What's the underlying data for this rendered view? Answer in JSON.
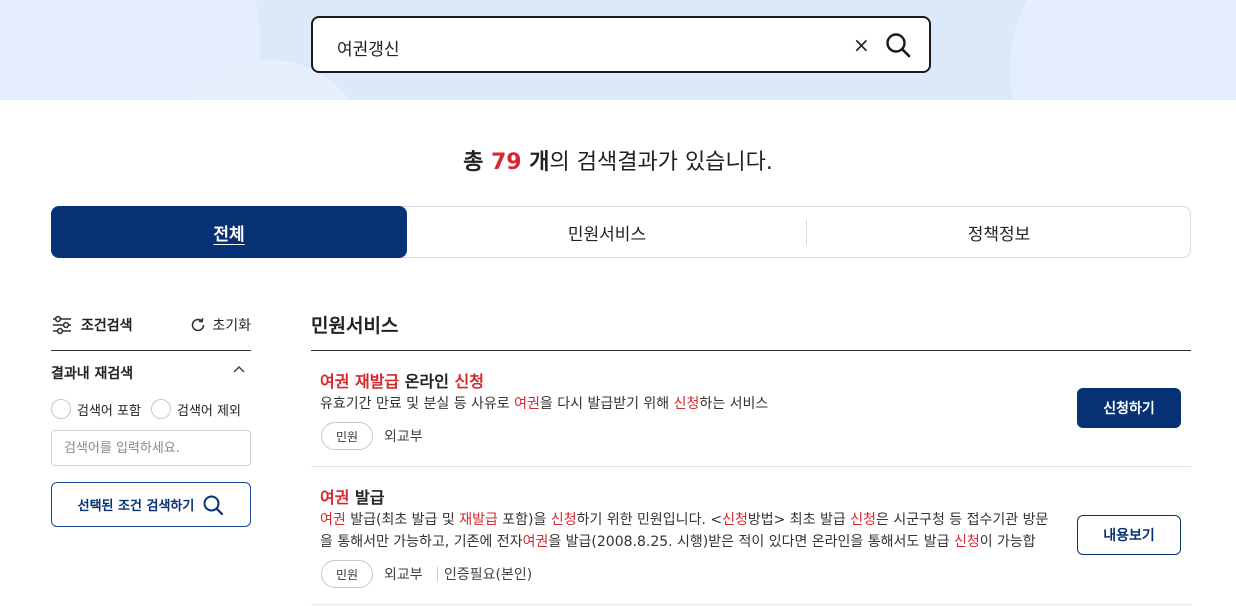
{
  "search": {
    "value": "여권갱신",
    "clear_icon": "×"
  },
  "result_summary": {
    "prefix": "총 ",
    "count": "79",
    "unit": " 개",
    "suffix": "의 검색결과가 있습니다."
  },
  "tabs": [
    {
      "label": "전체",
      "active": true
    },
    {
      "label": "민원서비스",
      "active": false
    },
    {
      "label": "정책정보",
      "active": false
    }
  ],
  "filter": {
    "title": "조건검색",
    "reset_label": "초기화",
    "refine_title": "결과내 재검색",
    "options": [
      {
        "label": "검색어 포함"
      },
      {
        "label": "검색어 제외"
      }
    ],
    "input_placeholder": "검색어를 입력하세요.",
    "apply_label": "선택된 조건 검색하기"
  },
  "section": {
    "title": "민원서비스"
  },
  "results": [
    {
      "title_parts": [
        {
          "text": "여권",
          "hl": true
        },
        {
          "text": " ",
          "hl": false
        },
        {
          "text": "재발급",
          "hl": true
        },
        {
          "text": " 온라인 ",
          "hl": false
        },
        {
          "text": "신청",
          "hl": true
        }
      ],
      "desc_parts": [
        {
          "text": "유효기간 만료 및 분실 등 사유로 ",
          "hl": false
        },
        {
          "text": "여권",
          "hl": true
        },
        {
          "text": "을 다시 발급받기 위해 ",
          "hl": false
        },
        {
          "text": "신청",
          "hl": true
        },
        {
          "text": "하는 서비스",
          "hl": false
        }
      ],
      "tag": "민원",
      "meta": [
        "외교부"
      ],
      "button": "신청하기"
    },
    {
      "title_parts": [
        {
          "text": "여권",
          "hl": true
        },
        {
          "text": " 발급",
          "hl": false
        }
      ],
      "desc_parts": [
        {
          "text": "여권",
          "hl": true
        },
        {
          "text": " 발급(최초 발급 및 ",
          "hl": false
        },
        {
          "text": "재발급",
          "hl": true
        },
        {
          "text": " 포함)을 ",
          "hl": false
        },
        {
          "text": "신청",
          "hl": true
        },
        {
          "text": "하기 위한 민원입니다. <",
          "hl": false
        },
        {
          "text": "신청",
          "hl": true
        },
        {
          "text": "방법> 최초 발급 ",
          "hl": false
        },
        {
          "text": "신청",
          "hl": true
        },
        {
          "text": "은 시군구청 등 접수기관 방문을 통해서만 가능하고, 기존에 전자",
          "hl": false
        },
        {
          "text": "여권",
          "hl": true
        },
        {
          "text": "을 발급(2008.8.25. 시행)받은 적이 있다면 온라인을 통해서도 발급 ",
          "hl": false
        },
        {
          "text": "신청",
          "hl": true
        },
        {
          "text": "이 가능합니…",
          "hl": false
        }
      ],
      "tag": "민원",
      "meta": [
        "외교부",
        "인증필요(본인)"
      ],
      "button": "내용보기"
    }
  ]
}
